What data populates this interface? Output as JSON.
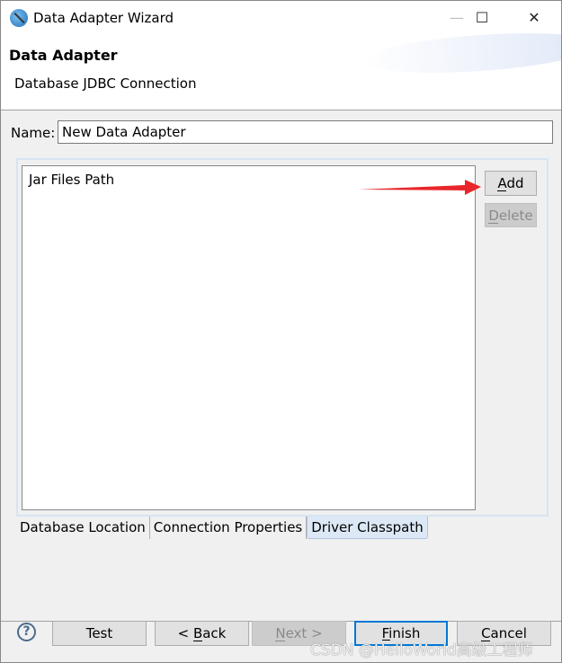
{
  "window": {
    "title": "Data Adapter Wizard",
    "controls": [
      "minimize",
      "maximize",
      "close"
    ]
  },
  "header": {
    "title": "Data Adapter",
    "subtitle": "Database JDBC Connection"
  },
  "name_field": {
    "label": "Name:",
    "value": "New Data Adapter"
  },
  "classpath": {
    "list_header": "Jar Files Path",
    "items": [],
    "add_label": "Add",
    "delete_label": "Delete"
  },
  "tabs": [
    {
      "label": "Database Location",
      "active": false
    },
    {
      "label": "Connection Properties",
      "active": false
    },
    {
      "label": "Driver Classpath",
      "active": true
    }
  ],
  "footer": {
    "test": "Test",
    "back": "< Back",
    "next": "Next >",
    "finish": "Finish",
    "cancel": "Cancel",
    "help_icon": "question-circle-icon"
  },
  "mnemonics": {
    "add": "A",
    "delete": "D",
    "back": "B",
    "next": "N",
    "finish": "F",
    "cancel": "C"
  },
  "annotation": {
    "arrow_color": "#e8262b"
  },
  "watermark": "CSDN @HelloWorld高级工程师"
}
